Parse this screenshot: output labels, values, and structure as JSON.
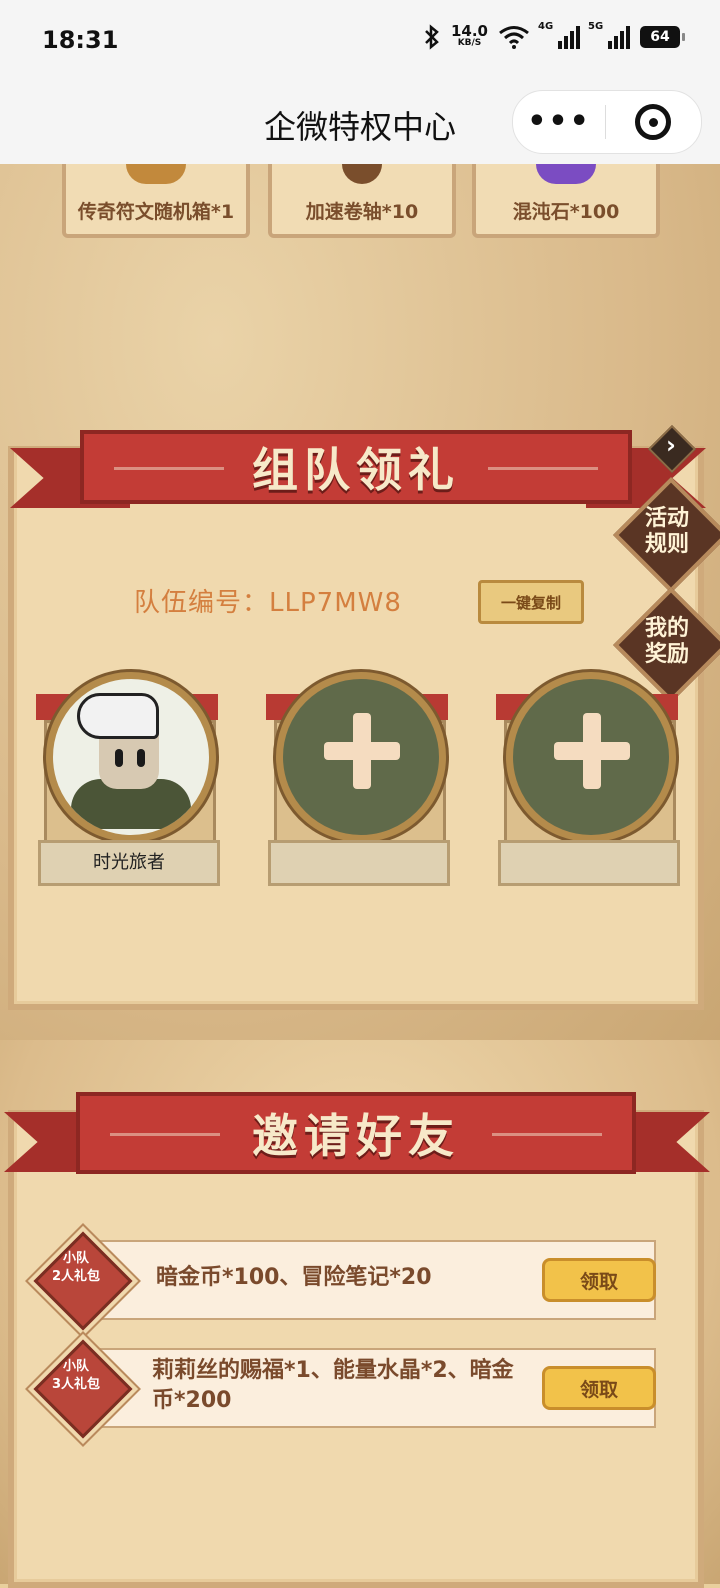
{
  "status_bar": {
    "time": "18:31",
    "net_speed_value": "14.0",
    "net_speed_unit": "KB/S",
    "signal_1": "4G",
    "signal_2": "5G",
    "battery": "64"
  },
  "nav": {
    "title": "企微特权中心",
    "more_label": "•••"
  },
  "rewards_top": [
    {
      "label": "传奇符文随机箱*1",
      "icon": "rune-box-icon"
    },
    {
      "label": "加速卷轴*10",
      "icon": "scroll-icon"
    },
    {
      "label": "混沌石*100",
      "icon": "chaos-stone-icon"
    }
  ],
  "team_section": {
    "title": "组队领礼",
    "team_id_label": "队伍编号：",
    "team_id": "LLP7MW8",
    "copy_button": "一键复制",
    "side_buttons": {
      "rules": [
        "活动",
        "规则"
      ],
      "my_rewards": [
        "我的",
        "奖励"
      ]
    },
    "members": [
      {
        "name": "时光旅者",
        "filled": true
      },
      {
        "name": "",
        "filled": false
      },
      {
        "name": "",
        "filled": false
      }
    ]
  },
  "invite_section": {
    "title": "邀请好友",
    "gifts": [
      {
        "badge": [
          "小队",
          "2人礼包"
        ],
        "text": "暗金币*100、冒险笔记*20",
        "button": "领取"
      },
      {
        "badge": [
          "小队",
          "3人礼包"
        ],
        "text": "莉莉丝的赐福*1、能量水晶*2、暗金币*200",
        "button": "领取"
      }
    ]
  },
  "colors": {
    "ribbon": "#c33c36",
    "panel": "#f0d9ae",
    "team_id_text": "#d47f3f",
    "claim_button": "#f2c24a"
  }
}
